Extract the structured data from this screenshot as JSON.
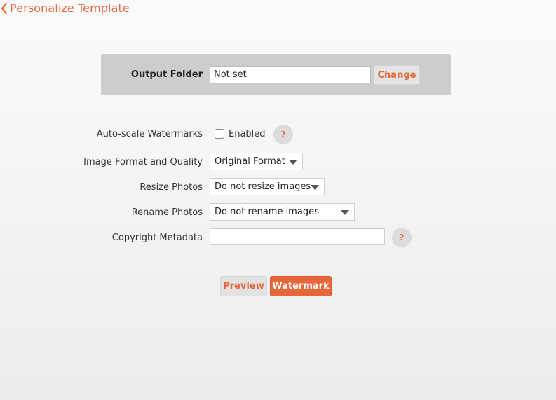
{
  "header": {
    "title": "Personalize Template",
    "back_icon": "chevron-left-icon"
  },
  "output_folder": {
    "label": "Output Folder",
    "value": "Not set",
    "change_label": "Change"
  },
  "settings": {
    "autoscale": {
      "label": "Auto-scale Watermarks",
      "checkbox_label": "Enabled",
      "checked": false,
      "help": "?"
    },
    "image_format": {
      "label": "Image Format and Quality",
      "selected": "Original Format"
    },
    "resize": {
      "label": "Resize Photos",
      "selected": "Do not resize images"
    },
    "rename": {
      "label": "Rename Photos",
      "selected": "Do not rename images"
    },
    "copyright": {
      "label": "Copyright Metadata",
      "value": "",
      "help": "?"
    }
  },
  "actions": {
    "preview_label": "Preview",
    "watermark_label": "Watermark"
  },
  "colors": {
    "accent": "#e5673a",
    "panel": "#cdcdcd"
  }
}
